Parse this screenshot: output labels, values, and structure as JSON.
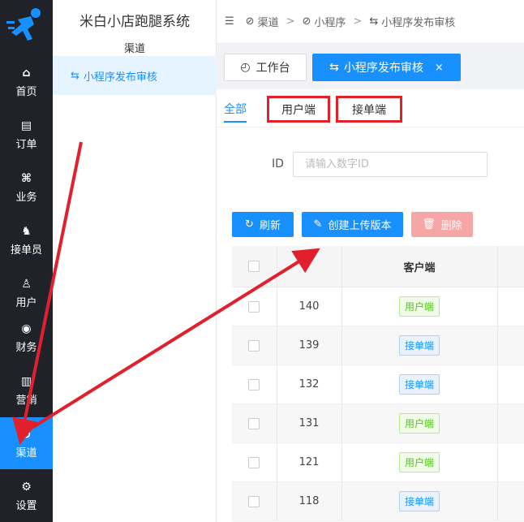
{
  "app": {
    "system_title": "米白小店跑腿系统"
  },
  "rail": {
    "items": [
      {
        "label": "首页",
        "icon": "home-icon",
        "glyph": "⌂"
      },
      {
        "label": "订单",
        "icon": "order-icon",
        "glyph": "▤"
      },
      {
        "label": "业务",
        "icon": "business-icon",
        "glyph": "⌘"
      },
      {
        "label": "接单员",
        "icon": "bike-icon",
        "glyph": "♞"
      },
      {
        "label": "用户",
        "icon": "user-icon",
        "glyph": "♙"
      },
      {
        "label": "财务",
        "icon": "finance-icon",
        "glyph": "◉"
      },
      {
        "label": "营销",
        "icon": "marketing-icon",
        "glyph": "▥"
      },
      {
        "label": "渠道",
        "icon": "channel-icon",
        "glyph": "⊘"
      },
      {
        "label": "设置",
        "icon": "settings-icon",
        "glyph": "⚙"
      }
    ],
    "active_index": 7
  },
  "subside": {
    "section_title": "渠道",
    "items": [
      {
        "label": "小程序发布审核",
        "glyph": "⇆"
      }
    ]
  },
  "breadcrumb": {
    "fold_glyph": "☰",
    "items": [
      {
        "label": "渠道",
        "glyph": "⊘"
      },
      {
        "label": "小程序",
        "glyph": "⊘"
      },
      {
        "label": "小程序发布审核",
        "glyph": "⇆"
      }
    ],
    "sep": ">"
  },
  "tags": {
    "home": {
      "label": "工作台",
      "glyph": "◴"
    },
    "active": {
      "label": "小程序发布审核",
      "glyph": "⇆",
      "close": "×"
    }
  },
  "tabs": {
    "all": "全部",
    "user": "用户端",
    "rider": "接单端"
  },
  "filter": {
    "id_label": "ID",
    "id_placeholder": "请输入数字ID"
  },
  "buttons": {
    "refresh": {
      "label": "刷新",
      "glyph": "↻"
    },
    "create": {
      "label": "创建上传版本",
      "glyph": "✎"
    },
    "delete": {
      "label": "删除",
      "glyph": "🗑"
    }
  },
  "table": {
    "header": {
      "client": "客户端"
    },
    "rows": [
      {
        "id": "140",
        "client": "用户端",
        "type": "user"
      },
      {
        "id": "139",
        "client": "接单端",
        "type": "rider"
      },
      {
        "id": "132",
        "client": "接单端",
        "type": "rider"
      },
      {
        "id": "131",
        "client": "用户端",
        "type": "user"
      },
      {
        "id": "121",
        "client": "用户端",
        "type": "user"
      },
      {
        "id": "118",
        "client": "接单端",
        "type": "rider"
      }
    ]
  },
  "colors": {
    "primary": "#1890ff",
    "rail_bg": "#1f2329",
    "annotation_red": "#e0202c",
    "danger_light": "#f7a6a6"
  }
}
